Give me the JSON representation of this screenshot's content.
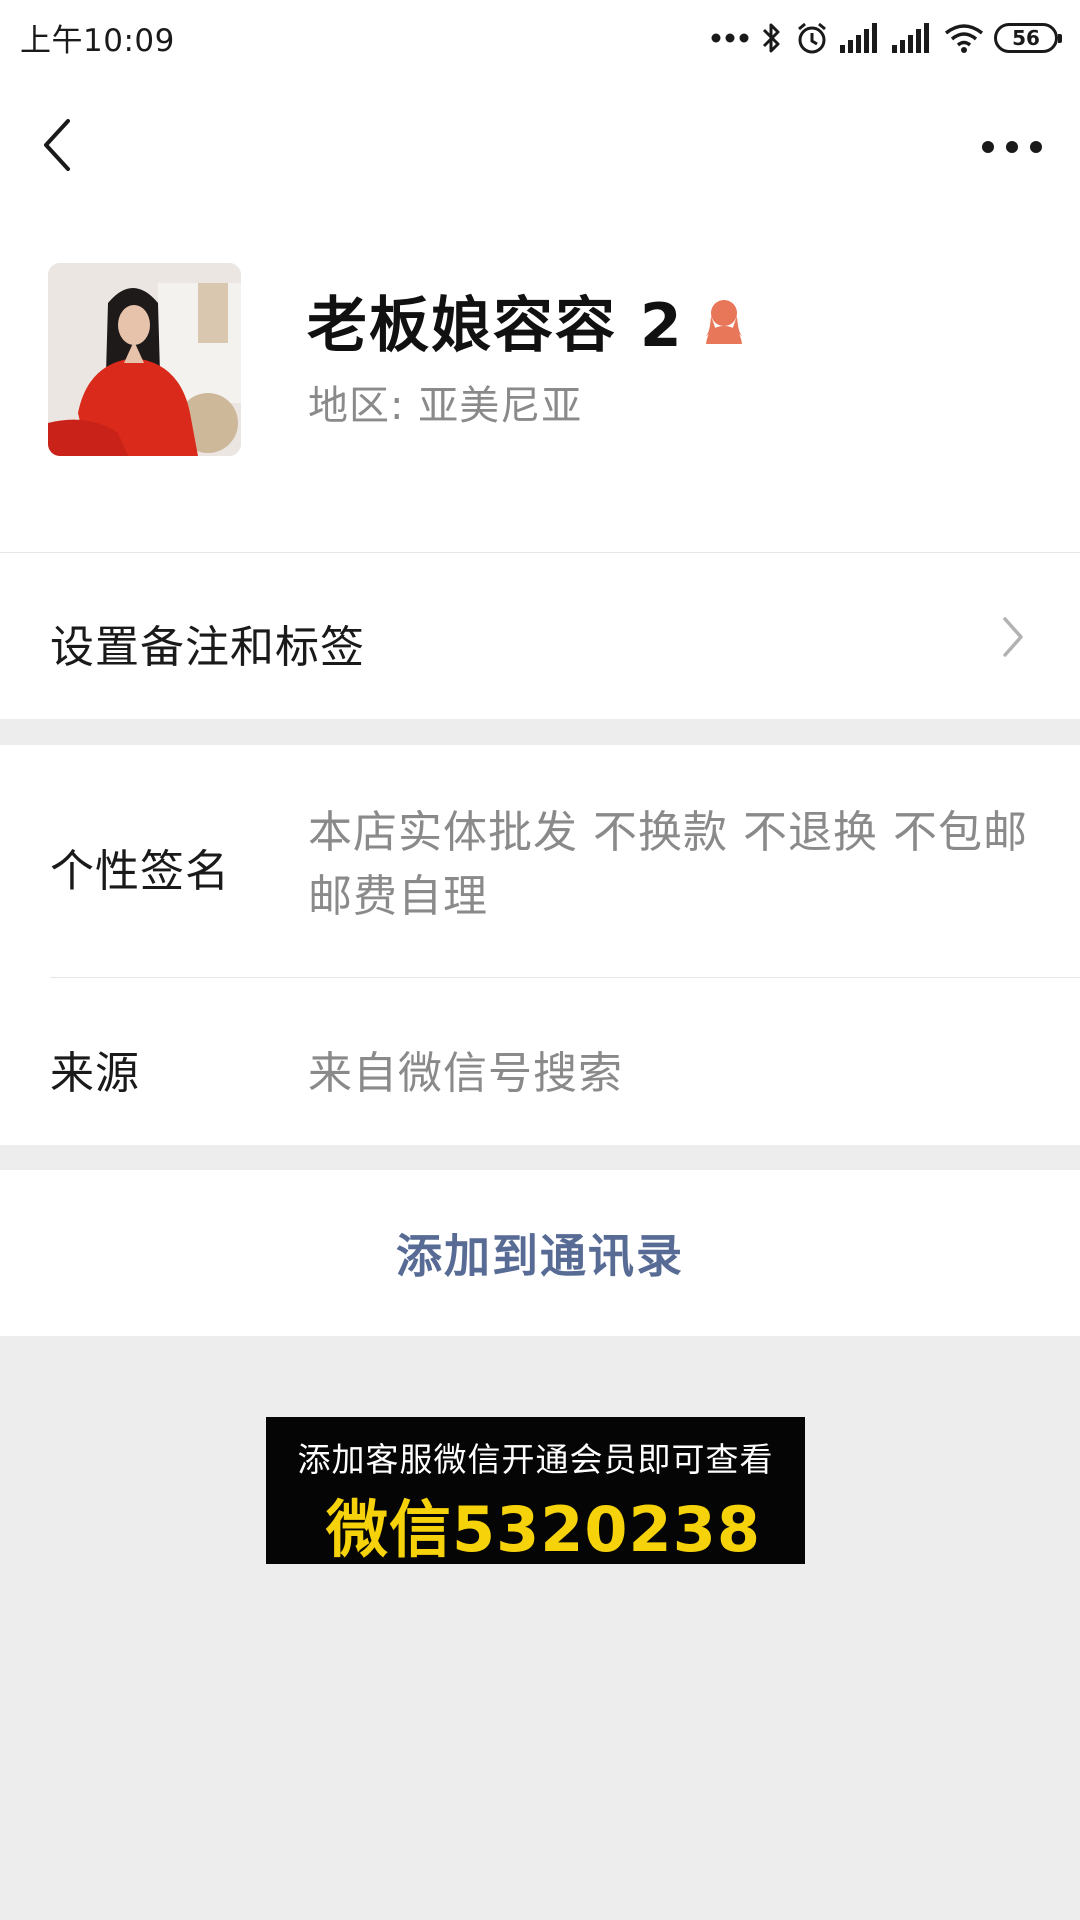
{
  "status_bar": {
    "time": "上午10:09",
    "battery": "56"
  },
  "profile": {
    "nickname": "老板娘容容 2",
    "region": "地区:  亚美尼亚"
  },
  "remark_cell": {
    "label": "设置备注和标签"
  },
  "signature": {
    "label": "个性签名",
    "value": "本店实体批发 不换款 不退换 不包邮 邮费自理"
  },
  "source": {
    "label": "来源",
    "value": "来自微信号搜索"
  },
  "add_button": {
    "label": "添加到通讯录"
  },
  "ad_banner": {
    "line1": "添加客服微信开通会员即可查看",
    "line2": "微信5320238"
  },
  "colors": {
    "link_blue": "#576b95",
    "page_bg": "#ededed",
    "ad_yellow": "#f6d20a",
    "gender_icon": "#e8775a"
  }
}
